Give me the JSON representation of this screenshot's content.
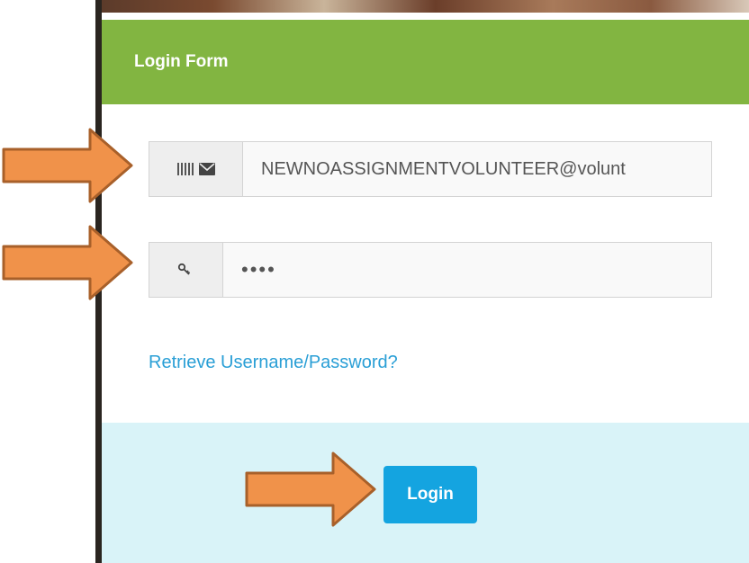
{
  "form": {
    "title": "Login Form",
    "email_value": "NEWNOASSIGNMENTVOLUNTEER@volunt",
    "password_value": "••••",
    "retrieve_link": "Retrieve Username/Password?",
    "login_label": "Login"
  },
  "icons": {
    "email_addon": [
      "barcode-icon",
      "envelope-icon"
    ],
    "password_addon": "key-icon",
    "annotation": "arrow-right-icon"
  },
  "colors": {
    "header": "#82b541",
    "footer": "#d9f3f8",
    "link": "#2a9fd6",
    "button": "#14a4e0",
    "arrow_fill": "#f0924a",
    "arrow_stroke": "#a8602a"
  }
}
